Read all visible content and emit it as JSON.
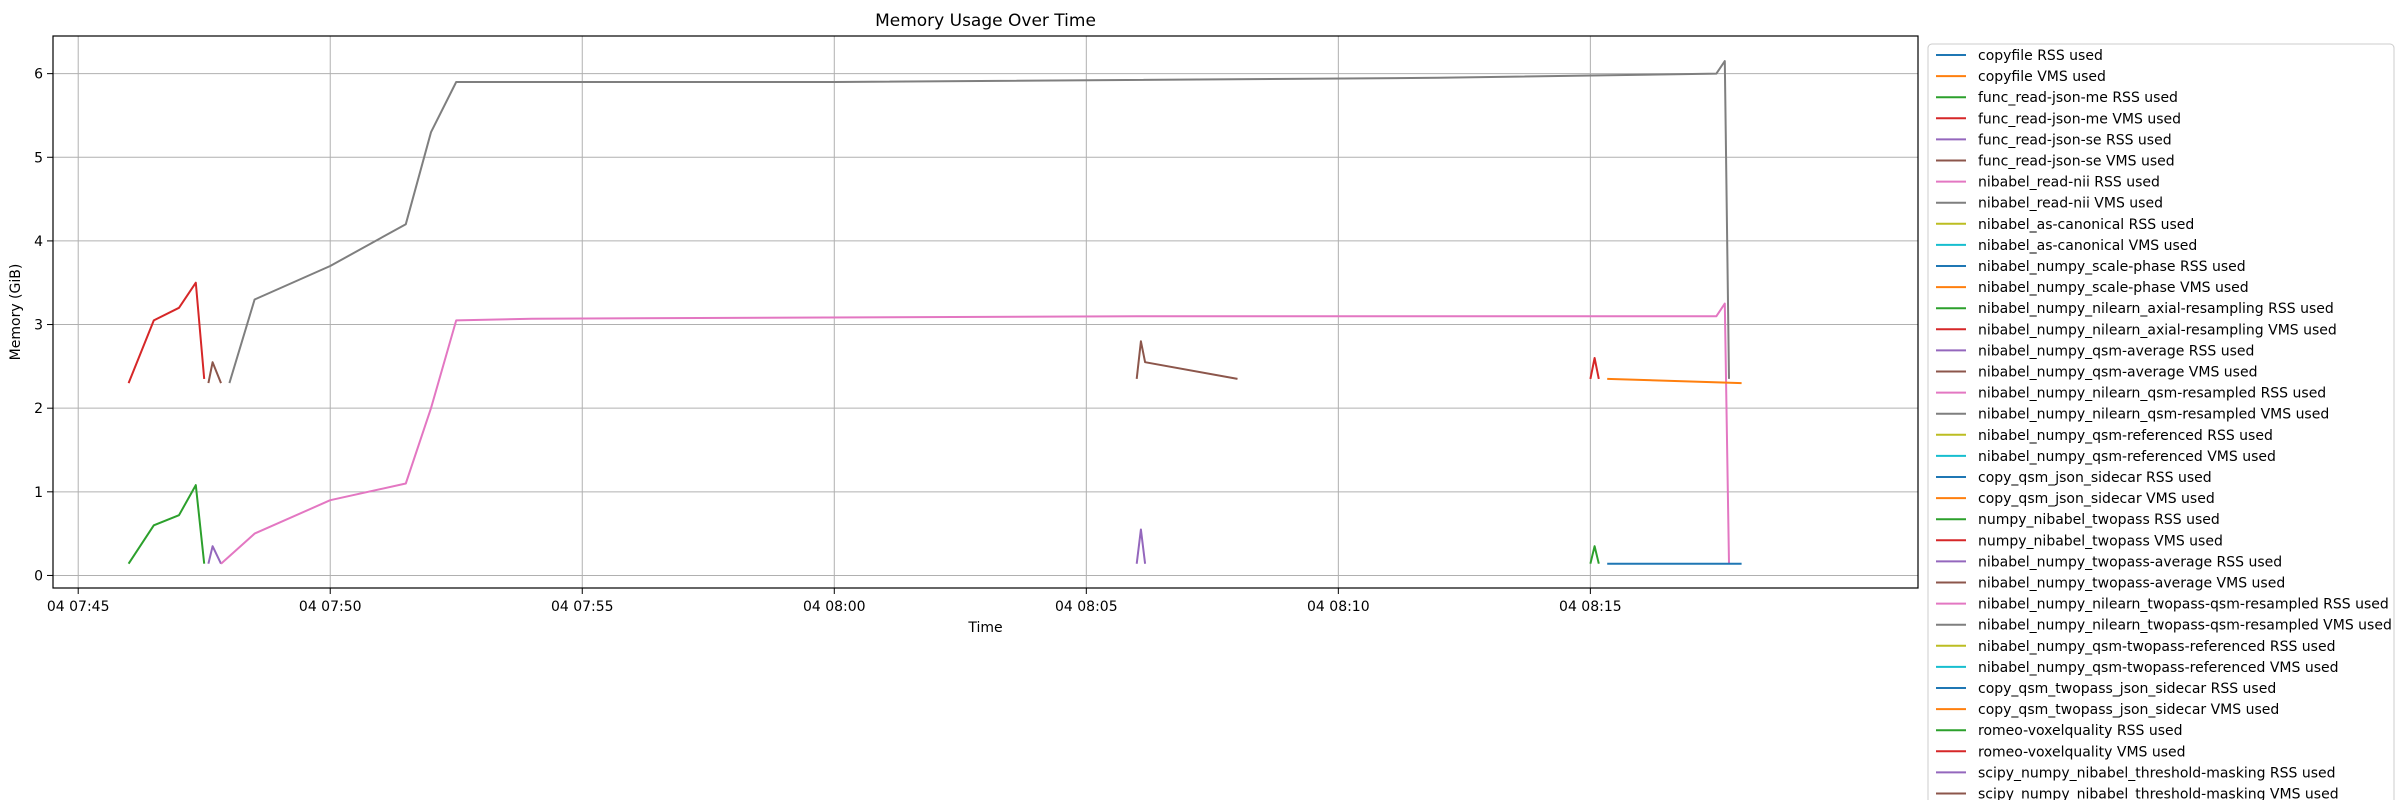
{
  "chart_data": {
    "type": "line",
    "title": "Memory Usage Over Time",
    "xlabel": "Time",
    "ylabel": "Memory (GiB)",
    "x_start": "04 07:44:30",
    "x_end": "04 08:21:30",
    "xlim_minutes": [
      0,
      37
    ],
    "ylim": [
      -0.15,
      6.45
    ],
    "grid": true,
    "legend_placement": "outside right",
    "x_ticks": [
      {
        "label": "04 07:45",
        "t": "04 07:45"
      },
      {
        "label": "04 07:50",
        "t": "04 07:50"
      },
      {
        "label": "04 07:55",
        "t": "04 07:55"
      },
      {
        "label": "04 08:00",
        "t": "04 08:00"
      },
      {
        "label": "04 08:05",
        "t": "04 08:05"
      },
      {
        "label": "04 08:10",
        "t": "04 08:10"
      },
      {
        "label": "04 08:15",
        "t": "04 08:15"
      }
    ],
    "y_ticks": [
      0,
      1,
      2,
      3,
      4,
      5,
      6
    ],
    "series": [
      {
        "name": "copyfile RSS used",
        "color": "#1f77b4",
        "points": []
      },
      {
        "name": "copyfile VMS used",
        "color": "#ff7f0e",
        "points": []
      },
      {
        "name": "func_read-json-me RSS used",
        "color": "#2ca02c",
        "points": [
          [
            "04 07:46:00",
            0.14
          ],
          [
            "04 07:46:30",
            0.6
          ],
          [
            "04 07:47:00",
            0.72
          ],
          [
            "04 07:47:20",
            1.08
          ],
          [
            "04 07:47:30",
            0.14
          ]
        ]
      },
      {
        "name": "func_read-json-me VMS used",
        "color": "#d62728",
        "points": [
          [
            "04 07:46:00",
            2.3
          ],
          [
            "04 07:46:30",
            3.05
          ],
          [
            "04 07:47:00",
            3.2
          ],
          [
            "04 07:47:20",
            3.5
          ],
          [
            "04 07:47:30",
            2.35
          ]
        ]
      },
      {
        "name": "func_read-json-se RSS used",
        "color": "#9467bd",
        "points": [
          [
            "04 07:47:35",
            0.14
          ],
          [
            "04 07:47:40",
            0.35
          ],
          [
            "04 07:47:50",
            0.14
          ]
        ]
      },
      {
        "name": "func_read-json-se VMS used",
        "color": "#8c564b",
        "points": [
          [
            "04 07:47:35",
            2.3
          ],
          [
            "04 07:47:40",
            2.55
          ],
          [
            "04 07:47:50",
            2.3
          ]
        ]
      },
      {
        "name": "nibabel_read-nii RSS used",
        "color": "#e377c2",
        "points": [
          [
            "04 07:47:50",
            0.14
          ],
          [
            "04 07:48:30",
            0.5
          ],
          [
            "04 07:50:00",
            0.9
          ],
          [
            "04 07:51:30",
            1.1
          ],
          [
            "04 07:52:00",
            2.0
          ],
          [
            "04 07:52:30",
            3.05
          ],
          [
            "04 07:54:00",
            3.07
          ],
          [
            "04 08:06:00",
            3.1
          ],
          [
            "04 08:15:00",
            3.1
          ],
          [
            "04 08:17:30",
            3.1
          ],
          [
            "04 08:17:40",
            3.25
          ],
          [
            "04 08:17:45",
            0.14
          ]
        ]
      },
      {
        "name": "nibabel_read-nii VMS used",
        "color": "#7f7f7f",
        "points": [
          [
            "04 07:48:00",
            2.3
          ],
          [
            "04 07:48:30",
            3.3
          ],
          [
            "04 07:50:00",
            3.7
          ],
          [
            "04 07:51:30",
            4.2
          ],
          [
            "04 07:52:00",
            5.3
          ],
          [
            "04 07:52:30",
            5.9
          ],
          [
            "04 08:00:00",
            5.9
          ],
          [
            "04 08:12:00",
            5.95
          ],
          [
            "04 08:17:30",
            6.0
          ],
          [
            "04 08:17:40",
            6.15
          ],
          [
            "04 08:17:45",
            2.35
          ]
        ]
      },
      {
        "name": "nibabel_as-canonical RSS used",
        "color": "#bcbd22",
        "points": []
      },
      {
        "name": "nibabel_as-canonical VMS used",
        "color": "#17becf",
        "points": []
      },
      {
        "name": "nibabel_numpy_scale-phase RSS used",
        "color": "#1f77b4",
        "points": [
          [
            "04 08:15:20",
            0.14
          ],
          [
            "04 08:18:00",
            0.14
          ]
        ]
      },
      {
        "name": "nibabel_numpy_scale-phase VMS used",
        "color": "#ff7f0e",
        "points": [
          [
            "04 08:15:20",
            2.35
          ],
          [
            "04 08:18:00",
            2.3
          ]
        ]
      },
      {
        "name": "nibabel_numpy_nilearn_axial-resampling RSS used",
        "color": "#2ca02c",
        "points": [
          [
            "04 08:15:00",
            0.14
          ],
          [
            "04 08:15:05",
            0.35
          ],
          [
            "04 08:15:10",
            0.14
          ]
        ]
      },
      {
        "name": "nibabel_numpy_nilearn_axial-resampling VMS used",
        "color": "#d62728",
        "points": [
          [
            "04 08:15:00",
            2.35
          ],
          [
            "04 08:15:05",
            2.6
          ],
          [
            "04 08:15:10",
            2.35
          ]
        ]
      },
      {
        "name": "nibabel_numpy_qsm-average RSS used",
        "color": "#9467bd",
        "points": [
          [
            "04 08:06:00",
            0.14
          ],
          [
            "04 08:06:05",
            0.55
          ],
          [
            "04 08:06:10",
            0.14
          ]
        ]
      },
      {
        "name": "nibabel_numpy_qsm-average VMS used",
        "color": "#8c564b",
        "points": [
          [
            "04 08:06:00",
            2.35
          ],
          [
            "04 08:06:05",
            2.8
          ],
          [
            "04 08:06:10",
            2.55
          ],
          [
            "04 08:08:00",
            2.35
          ]
        ]
      },
      {
        "name": "nibabel_numpy_nilearn_qsm-resampled RSS used",
        "color": "#e377c2",
        "points": []
      },
      {
        "name": "nibabel_numpy_nilearn_qsm-resampled VMS used",
        "color": "#7f7f7f",
        "points": []
      },
      {
        "name": "nibabel_numpy_qsm-referenced RSS used",
        "color": "#bcbd22",
        "points": []
      },
      {
        "name": "nibabel_numpy_qsm-referenced VMS used",
        "color": "#17becf",
        "points": []
      },
      {
        "name": "copy_qsm_json_sidecar RSS used",
        "color": "#1f77b4",
        "points": []
      },
      {
        "name": "copy_qsm_json_sidecar VMS used",
        "color": "#ff7f0e",
        "points": []
      },
      {
        "name": "numpy_nibabel_twopass RSS used",
        "color": "#2ca02c",
        "points": []
      },
      {
        "name": "numpy_nibabel_twopass VMS used",
        "color": "#d62728",
        "points": []
      },
      {
        "name": "nibabel_numpy_twopass-average RSS used",
        "color": "#9467bd",
        "points": []
      },
      {
        "name": "nibabel_numpy_twopass-average VMS used",
        "color": "#8c564b",
        "points": []
      },
      {
        "name": "nibabel_numpy_nilearn_twopass-qsm-resampled RSS used",
        "color": "#e377c2",
        "points": []
      },
      {
        "name": "nibabel_numpy_nilearn_twopass-qsm-resampled VMS used",
        "color": "#7f7f7f",
        "points": []
      },
      {
        "name": "nibabel_numpy_qsm-twopass-referenced RSS used",
        "color": "#bcbd22",
        "points": []
      },
      {
        "name": "nibabel_numpy_qsm-twopass-referenced VMS used",
        "color": "#17becf",
        "points": []
      },
      {
        "name": "copy_qsm_twopass_json_sidecar RSS used",
        "color": "#1f77b4",
        "points": []
      },
      {
        "name": "copy_qsm_twopass_json_sidecar VMS used",
        "color": "#ff7f0e",
        "points": []
      },
      {
        "name": "romeo-voxelquality RSS used",
        "color": "#2ca02c",
        "points": []
      },
      {
        "name": "romeo-voxelquality VMS used",
        "color": "#d62728",
        "points": []
      },
      {
        "name": "scipy_numpy_nibabel_threshold-masking RSS used",
        "color": "#9467bd",
        "points": []
      },
      {
        "name": "scipy_numpy_nibabel_threshold-masking VMS used",
        "color": "#8c564b",
        "points": []
      }
    ]
  }
}
